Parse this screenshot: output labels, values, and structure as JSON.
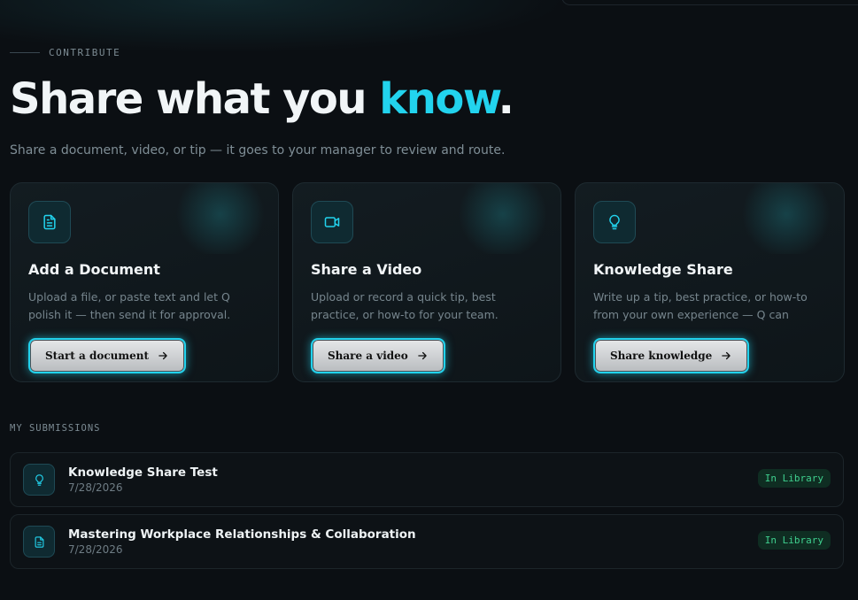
{
  "header": {
    "eyebrow": "CONTRIBUTE",
    "title_main": "Share what you ",
    "title_accent": "know",
    "title_end": ".",
    "subtitle": "Share a document, video, or tip — it goes to your manager to review and route."
  },
  "cards": [
    {
      "icon": "document-icon",
      "title": "Add a Document",
      "description": "Upload a file, or paste text and let Q polish it — then send it for approval.",
      "button_label": "Start a document"
    },
    {
      "icon": "video-camera-icon",
      "title": "Share a Video",
      "description": "Upload or record a quick tip, best practice, or how-to for your team.",
      "button_label": "Share a video"
    },
    {
      "icon": "lightbulb-icon",
      "title": "Knowledge Share",
      "description": "Write up a tip, best practice, or how-to from your own experience — Q can polish…",
      "button_label": "Share knowledge"
    }
  ],
  "submissions": {
    "label": "MY SUBMISSIONS",
    "items": [
      {
        "icon": "lightbulb-icon",
        "title": "Knowledge Share Test",
        "date": "7/28/2026",
        "status": "In Library"
      },
      {
        "icon": "document-icon",
        "title": "Mastering Workplace Relationships & Collaboration",
        "date": "7/28/2026",
        "status": "In Library"
      }
    ]
  },
  "colors": {
    "background": "#0b0f13",
    "accent": "#22d3ee",
    "status_green": "#3fcf8e"
  }
}
